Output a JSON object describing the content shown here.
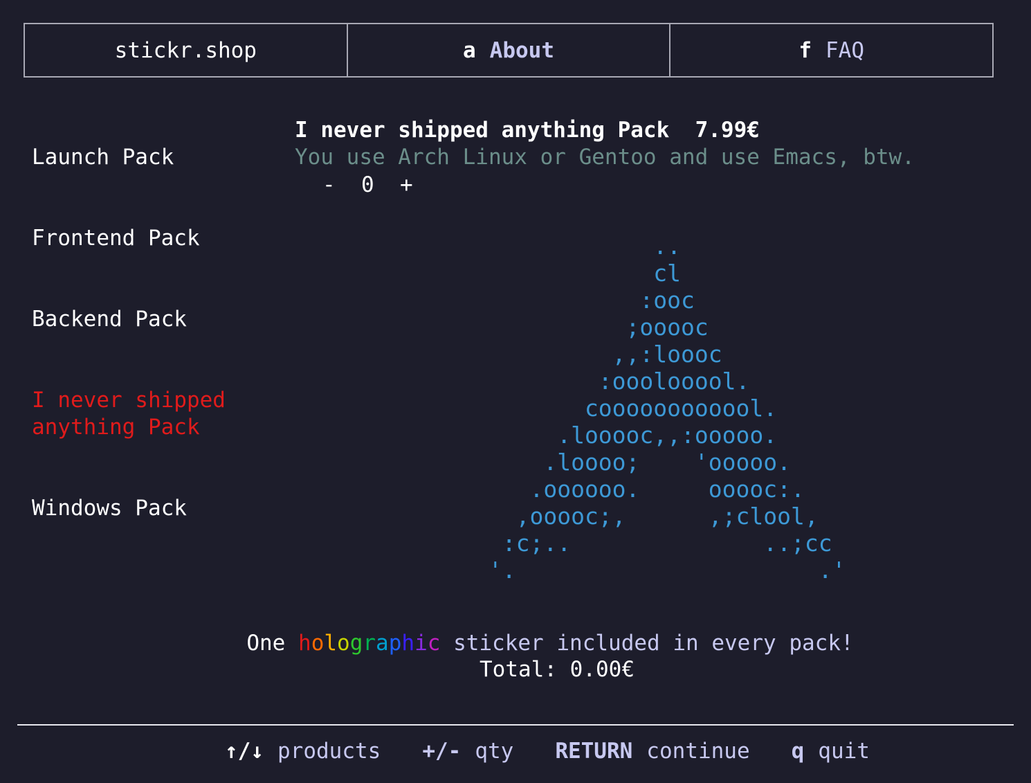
{
  "nav": {
    "brand": "stickr.shop",
    "about_key": "a",
    "about_label": "About",
    "faq_key": "f",
    "faq_label": "FAQ"
  },
  "sidebar": {
    "items": [
      {
        "label": "Launch Pack"
      },
      {
        "label": "Frontend Pack"
      },
      {
        "label": "Backend Pack"
      },
      {
        "label": "I never shipped\nanything Pack",
        "selected": true
      },
      {
        "label": "Windows Pack"
      }
    ]
  },
  "product": {
    "title": "I never shipped anything Pack",
    "price": "7.99€",
    "description": "You use Arch Linux or Gentoo and use Emacs, btw.",
    "qty_minus": "-",
    "qty_value": "0",
    "qty_plus": "+"
  },
  "ascii_art": "             ..\n             cl\n            :ooc\n           ;ooooc\n          ,,:loooc\n         :ooolooool.\n        coooooooooool.\n      .looooc,,:ooooo.\n     .loooo;    'ooooo.\n    .oooooo.     ooooc:.\n   ,ooooc;,      ,;clool,\n  :c;..              ..;cc\n '.                      .'",
  "promo": {
    "lead": "One ",
    "holo_letters": [
      "h",
      "o",
      "l",
      "o",
      "g",
      "r",
      "a",
      "p",
      "h",
      "i",
      "c"
    ],
    "holo_colors": [
      "#e01b1b",
      "#ff6a00",
      "#ffb000",
      "#c8d400",
      "#2ec82e",
      "#00b050",
      "#00a0d0",
      "#1e60ff",
      "#3a20ff",
      "#8a2be2",
      "#c020c0"
    ],
    "trail": " sticker included in every pack!",
    "total": "Total: 0.00€"
  },
  "footer": {
    "hints": [
      {
        "key": "↑/↓",
        "label": "products",
        "key_white": true
      },
      {
        "key": "+/-",
        "label": "qty",
        "key_white": false
      },
      {
        "key": "RETURN",
        "label": "continue",
        "key_white": false
      },
      {
        "key": "q",
        "label": "quit",
        "key_white": false
      }
    ]
  },
  "colors": {
    "background": "#1d1d2b",
    "accent_lavender": "#c7c8f0",
    "selected_red": "#e01b1b",
    "ascii_blue": "#3d99d6",
    "desc_teal": "#6b8e8a"
  }
}
